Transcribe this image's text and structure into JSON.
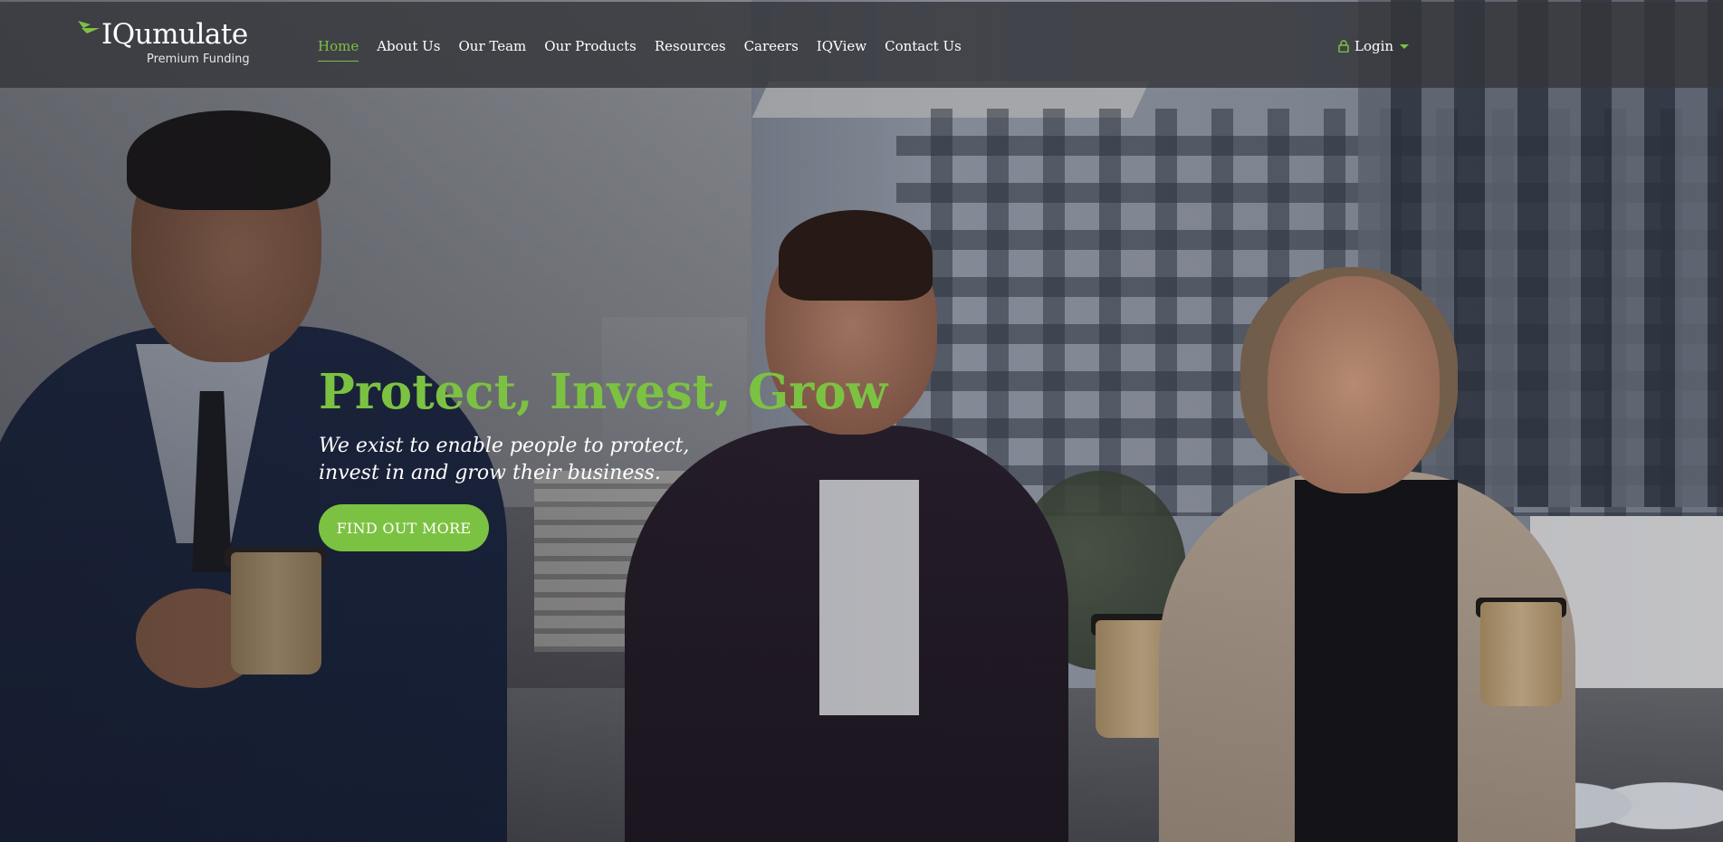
{
  "brand": {
    "name": "IQumulate",
    "tagline": "Premium Funding",
    "accent_color": "#7cc242"
  },
  "nav": {
    "items": [
      {
        "label": "Home",
        "active": true
      },
      {
        "label": "About Us",
        "active": false
      },
      {
        "label": "Our Team",
        "active": false
      },
      {
        "label": "Our Products",
        "active": false
      },
      {
        "label": "Resources",
        "active": false
      },
      {
        "label": "Careers",
        "active": false
      },
      {
        "label": "IQView",
        "active": false
      },
      {
        "label": "Contact Us",
        "active": false
      }
    ]
  },
  "login": {
    "label": "Login",
    "icon": "lock-icon",
    "dropdown_icon": "caret-down-icon"
  },
  "hero": {
    "title": "Protect, Invest, Grow",
    "subtitle_line1": "We exist to enable people to protect,",
    "subtitle_line2": "invest in and grow their business.",
    "cta_label": "FIND OUT MORE"
  }
}
